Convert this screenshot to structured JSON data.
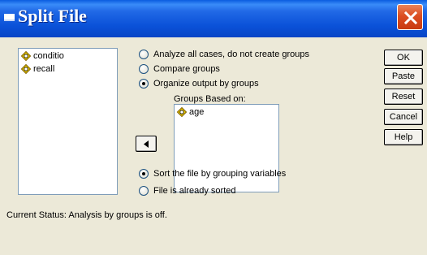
{
  "window": {
    "title": "Split File"
  },
  "variables": [
    {
      "name": "conditio",
      "icon": "scale-variable-icon"
    },
    {
      "name": "recall",
      "icon": "scale-variable-icon"
    }
  ],
  "options": {
    "analyze_all": {
      "label": "Analyze all cases, do not create groups",
      "selected": false
    },
    "compare_groups": {
      "label": "Compare groups",
      "selected": false
    },
    "organize_output": {
      "label": "Organize output by groups",
      "selected": true
    }
  },
  "groups": {
    "label": "Groups Based on:",
    "items": [
      {
        "name": "age",
        "icon": "scale-variable-icon"
      }
    ]
  },
  "sort_options": {
    "sort_by_grouping": {
      "label": "Sort the file by grouping variables",
      "selected": true
    },
    "already_sorted": {
      "label": "File is already sorted",
      "selected": false
    }
  },
  "buttons": {
    "ok": "OK",
    "paste": "Paste",
    "reset": "Reset",
    "cancel": "Cancel",
    "help": "Help"
  },
  "status": "Current Status:  Analysis by groups is off."
}
